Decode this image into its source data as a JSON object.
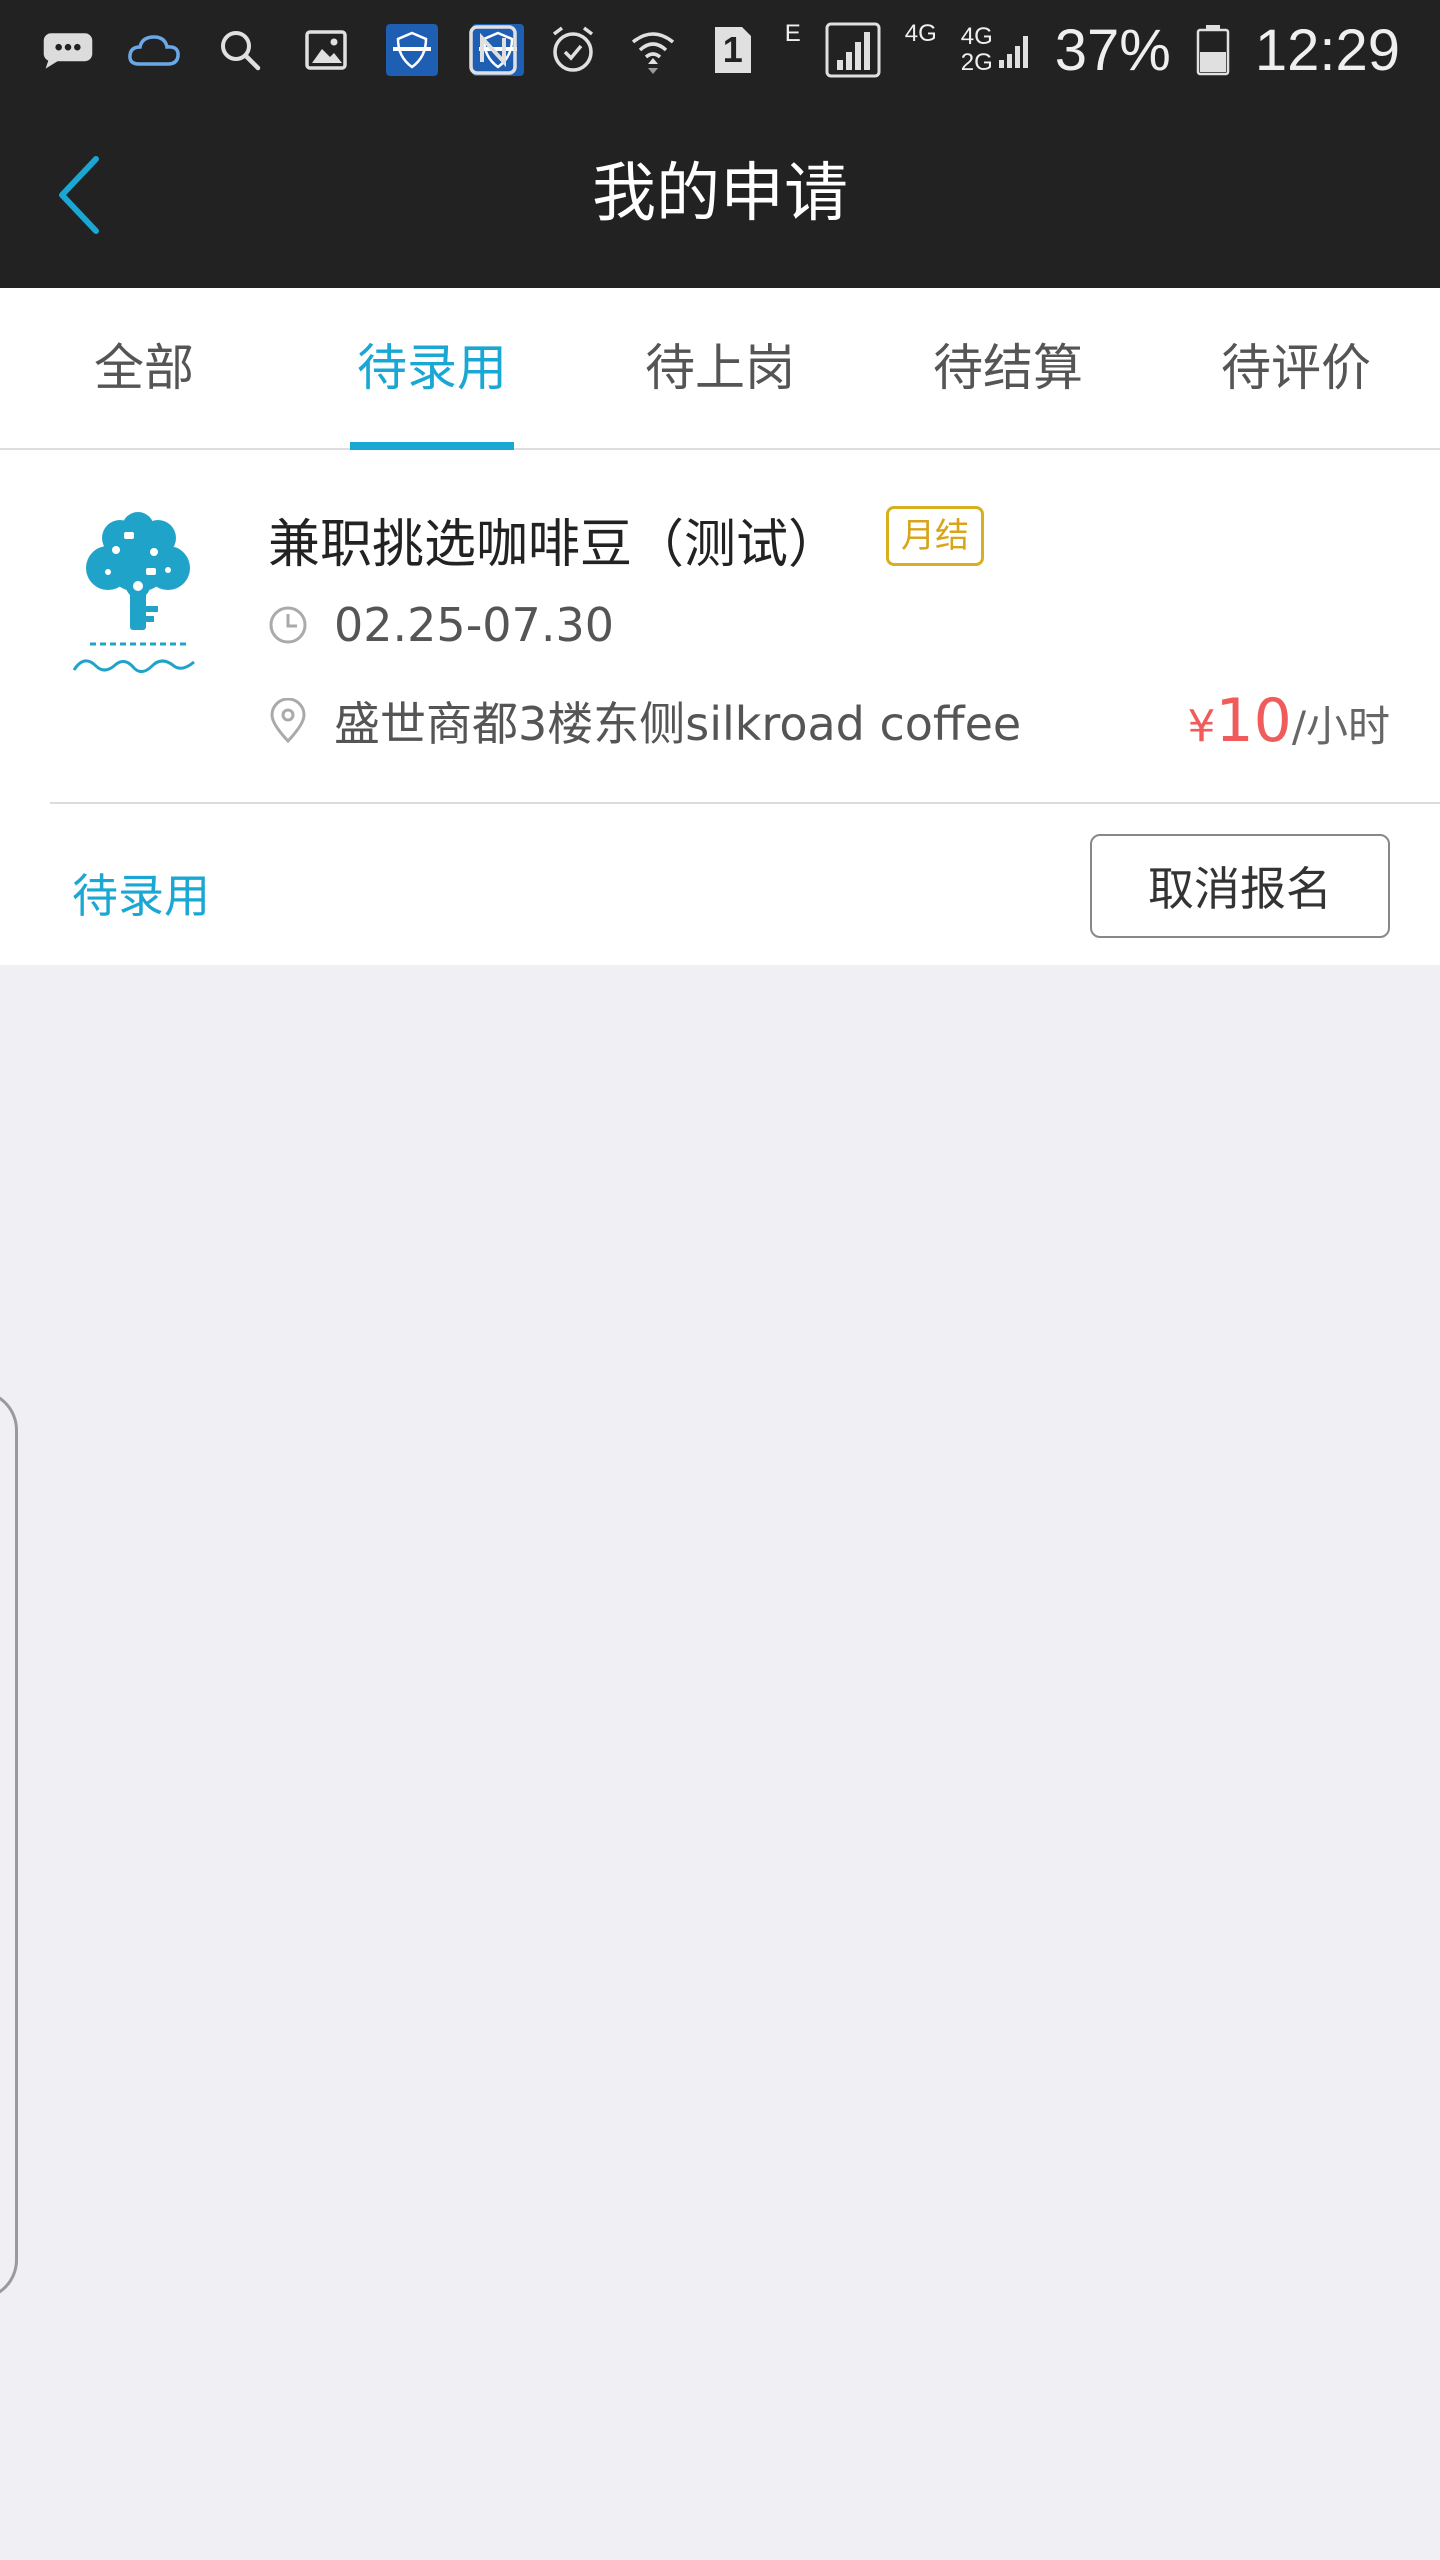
{
  "status_bar": {
    "sim_number": "1",
    "net_e": "E",
    "net_4g": "4G",
    "net_4g2g_top": "4G",
    "net_4g2g_bottom": "2G",
    "battery_percent": "37%",
    "time": "12:29",
    "icons": [
      "message-icon",
      "cloud-icon",
      "search-icon",
      "gallery-icon",
      "app-badge-icon",
      "app-badge-icon",
      "nfc-icon",
      "alarm-icon",
      "wifi-icon",
      "signal-icon",
      "battery-icon"
    ]
  },
  "nav": {
    "title": "我的申请",
    "back_icon": "chevron-left-icon"
  },
  "tabs": [
    {
      "label": "全部",
      "active": false
    },
    {
      "label": "待录用",
      "active": true
    },
    {
      "label": "待上岗",
      "active": false
    },
    {
      "label": "待结算",
      "active": false
    },
    {
      "label": "待评价",
      "active": false
    }
  ],
  "job": {
    "title": "兼职挑选咖啡豆（测试）",
    "settlement_badge": "月结",
    "date_range": "02.25-07.30",
    "address": "盛世商都3楼东侧silkroad coffee",
    "price_symbol": "¥",
    "price_value": "10",
    "price_unit": "/小时",
    "status": "待录用",
    "cancel_label": "取消报名"
  },
  "colors": {
    "accent": "#1aa7d4",
    "price": "#f05b5b",
    "badge": "#d8a51a",
    "header_bg": "#222222",
    "page_bg": "#efeff4"
  }
}
